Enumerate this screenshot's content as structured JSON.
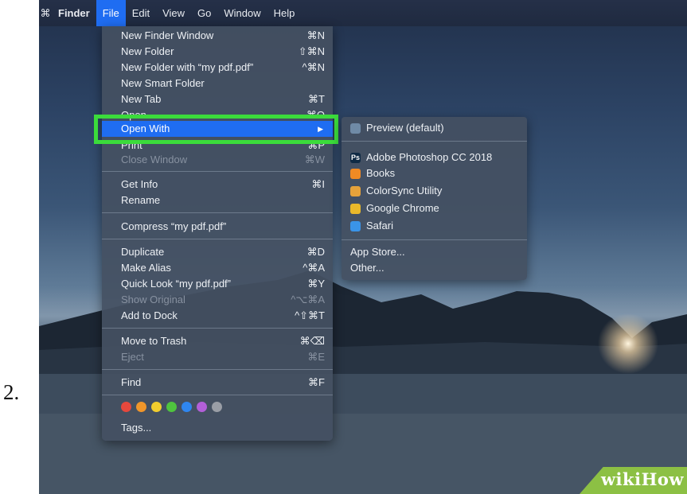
{
  "step_number": "2.",
  "menubar": {
    "apple_icon": "apple-icon",
    "items": [
      "Finder",
      "File",
      "Edit",
      "View",
      "Go",
      "Window",
      "Help"
    ]
  },
  "file_menu": {
    "items": [
      {
        "label": "New Finder Window",
        "shortcut": "⌘N",
        "disabled": false
      },
      {
        "label": "New Folder",
        "shortcut": "⇧⌘N",
        "disabled": false
      },
      {
        "label": "New Folder with “my pdf.pdf”",
        "shortcut": "^⌘N",
        "disabled": false
      },
      {
        "label": "New Smart Folder",
        "shortcut": "",
        "disabled": false
      },
      {
        "label": "New Tab",
        "shortcut": "⌘T",
        "disabled": false
      },
      {
        "label": "Open",
        "shortcut": "⌘O",
        "disabled": false
      },
      {
        "label": "Open With",
        "shortcut": "▶",
        "disabled": false,
        "highlighted": true
      },
      {
        "label": "Print",
        "shortcut": "⌘P",
        "disabled": false
      },
      {
        "label": "Close Window",
        "shortcut": "⌘W",
        "disabled": true
      },
      {
        "label": "Get Info",
        "shortcut": "⌘I",
        "disabled": false
      },
      {
        "label": "Rename",
        "shortcut": "",
        "disabled": false
      },
      {
        "label": "Compress “my pdf.pdf”",
        "shortcut": "",
        "disabled": false
      },
      {
        "label": "Duplicate",
        "shortcut": "⌘D",
        "disabled": false
      },
      {
        "label": "Make Alias",
        "shortcut": "^⌘A",
        "disabled": false
      },
      {
        "label": "Quick Look “my pdf.pdf”",
        "shortcut": "⌘Y",
        "disabled": false
      },
      {
        "label": "Show Original",
        "shortcut": "^⌥⌘A",
        "disabled": true
      },
      {
        "label": "Add to Dock",
        "shortcut": "^⇧⌘T",
        "disabled": false
      },
      {
        "label": "Move to Trash",
        "shortcut": "⌘⌫",
        "disabled": false
      },
      {
        "label": "Eject",
        "shortcut": "⌘E",
        "disabled": true
      },
      {
        "label": "Find",
        "shortcut": "⌘F",
        "disabled": false
      },
      {
        "label": "Tags...",
        "shortcut": "",
        "disabled": false
      }
    ],
    "tag_colors": [
      "#e5483d",
      "#f0962a",
      "#f2cd2e",
      "#4fc43e",
      "#2f86f0",
      "#b25fd8",
      "#9a9ea6"
    ]
  },
  "open_with_submenu": {
    "items": [
      {
        "label": "Preview (default)",
        "icon": "preview-icon",
        "icon_color": "#6f8aa6"
      },
      {
        "label": "Adobe Photoshop CC 2018",
        "icon": "photoshop-icon",
        "icon_color": "#0f2a44",
        "icon_text": "Ps"
      },
      {
        "label": "Books",
        "icon": "books-icon",
        "icon_color": "#f08a24"
      },
      {
        "label": "ColorSync Utility",
        "icon": "colorsync-icon",
        "icon_color": "#e6a23a"
      },
      {
        "label": "Google Chrome",
        "icon": "chrome-icon",
        "icon_color": "#e9b82a"
      },
      {
        "label": "Safari",
        "icon": "safari-icon",
        "icon_color": "#3a94e8"
      },
      {
        "label": "App Store...",
        "icon": ""
      },
      {
        "label": "Other...",
        "icon": ""
      }
    ]
  },
  "watermark": {
    "text": "wikiHow"
  },
  "colors": {
    "highlight": "#1f6df2",
    "annotation_box": "#3bdb3b"
  }
}
